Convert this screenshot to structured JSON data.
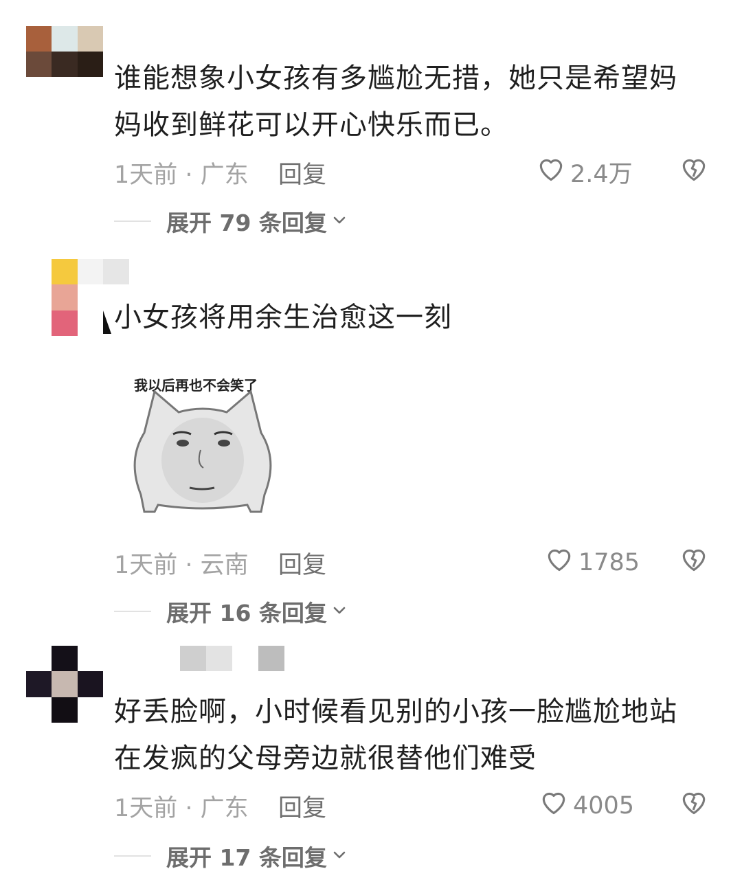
{
  "comments": [
    {
      "text_line1": "谁能想象小女孩有多尴尬无措，她只是希望妈",
      "text_line2": "妈收到鲜花可以开心快乐而已。",
      "meta": "1天前 · 广东",
      "reply_label": "回复",
      "likes": "2.4万",
      "expand_label": "展开 79 条回复"
    },
    {
      "text_line1": "小女孩将用余生治愈这一刻",
      "sticker_caption": "我以后再也不会笑了",
      "meta": "1天前 · 云南",
      "reply_label": "回复",
      "likes": "1785",
      "expand_label": "展开 16 条回复"
    },
    {
      "text_line1": "好丢脸啊，小时候看见别的小孩一脸尴尬地站",
      "text_line2": "在发疯的父母旁边就很替他们难受",
      "meta": "1天前 · 广东",
      "reply_label": "回复",
      "likes": "4005",
      "expand_label": "展开 17 条回复"
    }
  ],
  "colors": {
    "text": "#1f1f1f",
    "meta": "#a3a3a3",
    "icon": "#7a7a7a"
  },
  "icons": {
    "like": "heart-outline-icon",
    "dislike": "broken-heart-icon",
    "expand": "chevron-down-icon"
  }
}
